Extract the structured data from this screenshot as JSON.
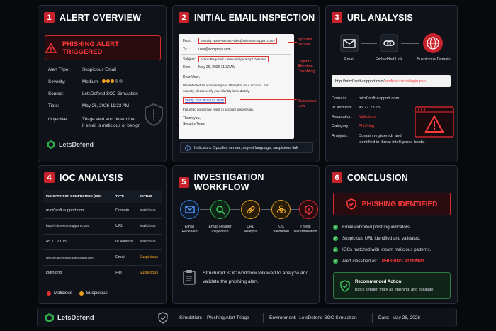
{
  "panel1": {
    "num": "1",
    "title": "ALERT OVERVIEW",
    "banner": "PHISHING ALERT TRIGGERED",
    "rows": [
      {
        "k": "Alert Type:",
        "v": "Suspicious Email"
      },
      {
        "k": "Severity:",
        "v": "Medium",
        "level_of_5": 3
      },
      {
        "k": "Source:",
        "v": "LetsDefend SOC Simulation"
      },
      {
        "k": "Tiate:",
        "v": "May 26, 2026 11:32 AM"
      },
      {
        "k": "Objective:",
        "v": "Triage alert and determine",
        "v2": "if email is malicious or benign"
      }
    ],
    "logo": "LetsDefend"
  },
  "panel2": {
    "num": "2",
    "title": "INITIAL EMAIL INSPECTION",
    "from_label": "From:",
    "from_value": "Security Team <security-alert@micr0soft-support.com>",
    "to_label": "To:",
    "to_value": "user@company.com",
    "subject_label": "Subject:",
    "subject_value": "Action Required: Unusual Sign Atmpt Detected",
    "date_label": "Date:",
    "date_value": "May 26, 2026 11:32 AM",
    "greeting": "Dear User,",
    "body1": "We detected an unusual sign-in attempt to your account. For",
    "body2": "security, please verify your identity immediately.",
    "link": "Verify Your Account Here",
    "body3": "Failure to do so may result in account suspension.",
    "thanks": "Thank you,",
    "sign": "Security Team",
    "callout_sender": "Spoofed Sender",
    "callout_urgent": "Urgent / Attention Dashbling",
    "callout_link": "Suspicious Link",
    "indicators": "Indicators: Spoofed sender, urgent language, suspicious link"
  },
  "panel3": {
    "num": "3",
    "title": "URL ANALYSIS",
    "flow": [
      "Email",
      "Embedded Link",
      "Suspicious Domain"
    ],
    "url_prefix": "http://micr0soft-support.com/",
    "url_path": "verify-account/login.php",
    "rows": [
      {
        "k": "Domain:",
        "v": "micr0soft-support.com"
      },
      {
        "k": "IP Address:",
        "v": "45.77.23.15"
      },
      {
        "k": "Reputation:",
        "v": "Malicious"
      },
      {
        "k": "Category:",
        "v": "Phishing"
      },
      {
        "k": "Analysis:",
        "v": "Domain registeredr and",
        "v2": "identified in threat intelligence feeds."
      }
    ]
  },
  "panel4": {
    "num": "4",
    "title": "IOC ANALYSIS",
    "headers": [
      "INDICATOR OF COMPROMISE (IOC)",
      "TYPE",
      "STATUS"
    ],
    "rows": [
      {
        "ioc": "micr0soft-support.com",
        "type": "Domain",
        "status": "Malicious"
      },
      {
        "ioc": "http://micr0soft-support.com/",
        "type": "URL",
        "status": "Malicious"
      },
      {
        "ioc": "45.77.23.15",
        "type": "IP Address",
        "status": "Malicious"
      },
      {
        "ioc": "security-alert@micr0soft-support.com",
        "type": "Email",
        "status": "Suspicious"
      },
      {
        "ioc": "login.php",
        "type": "File",
        "status": "Suspicious"
      }
    ],
    "legend": [
      "Malicious",
      "Suspicious"
    ]
  },
  "panel5": {
    "num": "5",
    "title": "INVESTIGATION WORKFLOW",
    "steps": [
      {
        "l1": "Email",
        "l2": "Received"
      },
      {
        "l1": "Email Header",
        "l2": "Inspection"
      },
      {
        "l1": "URL",
        "l2": "Analysis"
      },
      {
        "l1": "IOC",
        "l2": "Validation"
      },
      {
        "l1": "Threat",
        "l2": "Determination"
      }
    ],
    "summary1": "Structured SOC workflow followed to analyze and",
    "summary2": "validate the phishing alert."
  },
  "panel6": {
    "num": "6",
    "title": "CONCLUSION",
    "banner": "PHISHING IDENTIFIED",
    "items": [
      "Email exhibited phishing indicators.",
      "Suspicious URL identified and validated.",
      "IOCs matched with known malicious patterns."
    ],
    "classified_label": "Alert classified as:",
    "classified_value": "PHISHING ATTEMPT",
    "rec_title": "Recommended Action:",
    "rec_text": "Block sender, mark as phishing, and escalate."
  },
  "footer": {
    "logo": "LetsDefend",
    "sim_label": "Simulation:",
    "sim_value": "Phishing Alert Triage",
    "env_label": "Environment:",
    "env_value": "LetsDefend SOC Simulation",
    "date_label": "Date:",
    "date_value": "May 26, 2026"
  },
  "colors": {
    "accent_red": "#c8222c",
    "malicious": "#ff3b3b",
    "suspicious": "#f0a020",
    "ok_green": "#2faa4a"
  }
}
